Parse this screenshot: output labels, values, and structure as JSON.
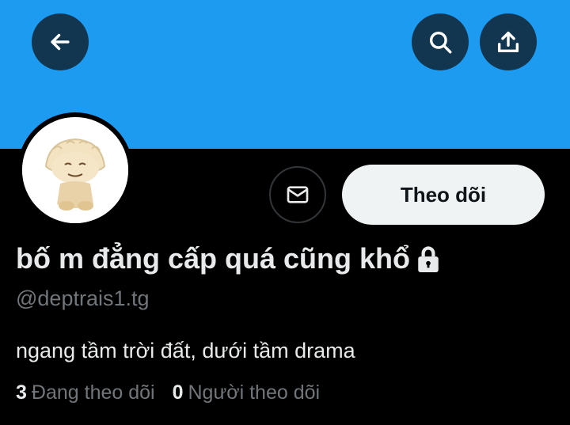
{
  "colors": {
    "banner": "#1d9bf0",
    "background": "#000000",
    "text_primary": "#e7e9ea",
    "text_secondary": "#71767b",
    "follow_button_bg": "#eff3f4"
  },
  "header": {
    "icons": {
      "back": "arrow-left-icon",
      "search": "search-icon",
      "share": "share-upload-icon"
    }
  },
  "profile": {
    "display_name": "bố m đẳng cấp quá cũng khổ",
    "protected_icon": "lock-icon",
    "handle": "@deptrais1.tg",
    "bio": "ngang tầm trời đất, dưới tầm drama",
    "follow_label": "Theo dõi",
    "message_icon": "envelope-icon",
    "following_count": "3",
    "following_label": "Đang theo dõi",
    "followers_count": "0",
    "followers_label": "Người theo dõi"
  }
}
